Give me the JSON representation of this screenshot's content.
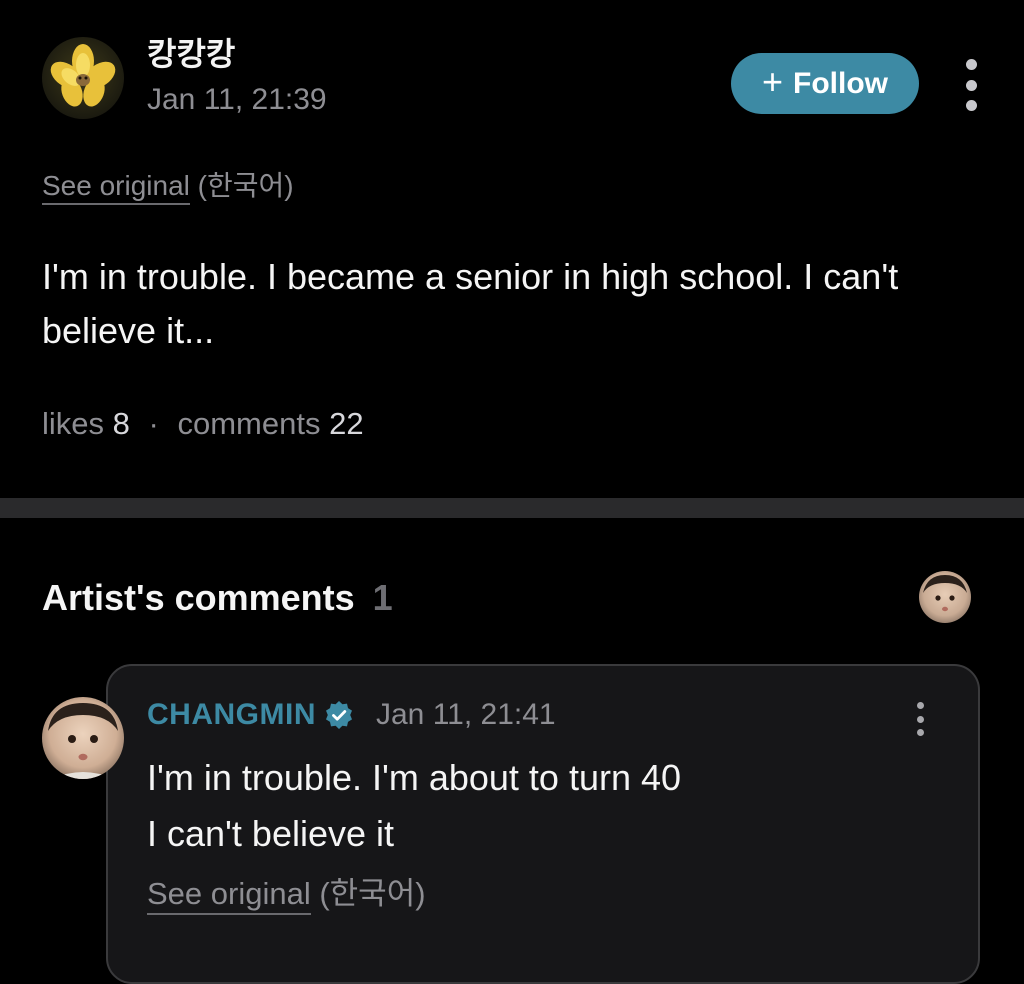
{
  "post": {
    "author": "캉캉캉",
    "timestamp": "Jan 11, 21:39",
    "avatar_icon": "yellow-flower-avatar",
    "follow_button": {
      "icon": "+",
      "label": "Follow"
    },
    "more_icon": "vertical-ellipsis-icon",
    "translation": {
      "link_label": "See original",
      "language": "(한국어)"
    },
    "body": "I'm in trouble. I became a senior in high school. I can't believe it...",
    "stats": {
      "likes_label": "likes",
      "likes_count": "8",
      "separator": "·",
      "comments_label": "comments",
      "comments_count": "22"
    }
  },
  "artist_comments": {
    "title": "Artist's comments",
    "count": "1",
    "comments": [
      {
        "author": "CHANGMIN",
        "verified": true,
        "timestamp": "Jan 11, 21:41",
        "body_lines": [
          "I'm in trouble. I'm about to turn 40",
          "I can't believe it"
        ],
        "translation": {
          "link_label": "See original",
          "language": "(한국어)"
        }
      }
    ]
  },
  "colors": {
    "background": "#000000",
    "accent": "#3d8aa4",
    "muted_text": "#8e8e93",
    "divider": "#2a2a2c",
    "card_border": "#3a3a3c"
  }
}
